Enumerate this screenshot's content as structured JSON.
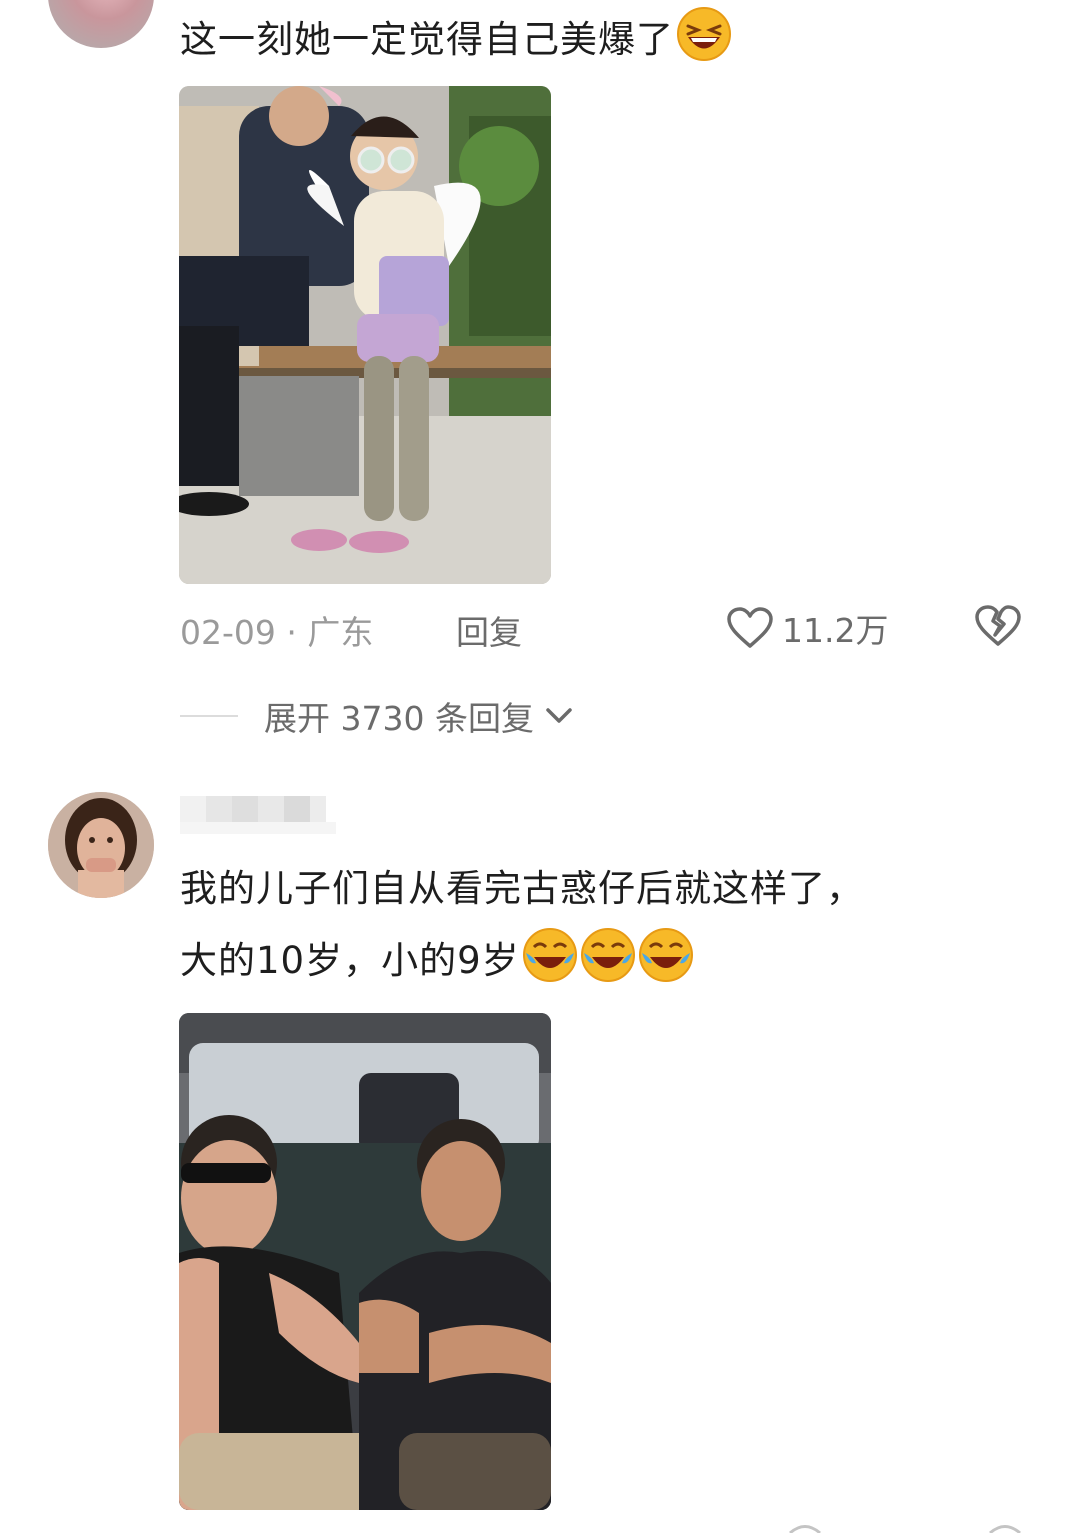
{
  "comment1": {
    "text": "这一刻她一定觉得自己美爆了",
    "emoji": "grinning-squint-emoji",
    "date": "02-09",
    "location": "广东",
    "reply_label": "回复",
    "like_count": "11.2万"
  },
  "expand": {
    "label": "展开 3730 条回复"
  },
  "comment2": {
    "line1": "我的儿子们自从看完古惑仔后就这样了，",
    "line2": "大的10岁，小的9岁",
    "emojis": [
      "tears-of-joy-emoji",
      "tears-of-joy-emoji",
      "tears-of-joy-emoji"
    ]
  },
  "colors": {
    "text": "#1e1e1e",
    "muted": "#9a9a9a",
    "action": "#6b6b6b",
    "emoji": "#f7b928"
  }
}
